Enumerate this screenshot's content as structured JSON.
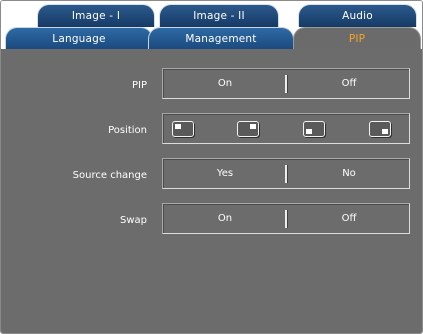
{
  "tabs_top": [
    {
      "label": "Image - I"
    },
    {
      "label": "Image - II"
    },
    {
      "label": "Audio"
    }
  ],
  "tabs_bottom": [
    {
      "label": "Language"
    },
    {
      "label": "Management"
    },
    {
      "label": "PIP",
      "active": true
    }
  ],
  "rows": {
    "pip": {
      "label": "PIP",
      "options": [
        "On",
        "Off"
      ]
    },
    "position": {
      "label": "Position",
      "icons": [
        "pip-top-left-icon",
        "pip-top-right-icon",
        "pip-bottom-left-icon",
        "pip-bottom-right-icon"
      ]
    },
    "source_change": {
      "label": "Source change",
      "options": [
        "Yes",
        "No"
      ]
    },
    "swap": {
      "label": "Swap",
      "options": [
        "On",
        "Off"
      ]
    }
  },
  "colors": {
    "panel": "#6c6c6c",
    "tab": "#1b4a7f",
    "active_tab_text": "#f5a623"
  }
}
